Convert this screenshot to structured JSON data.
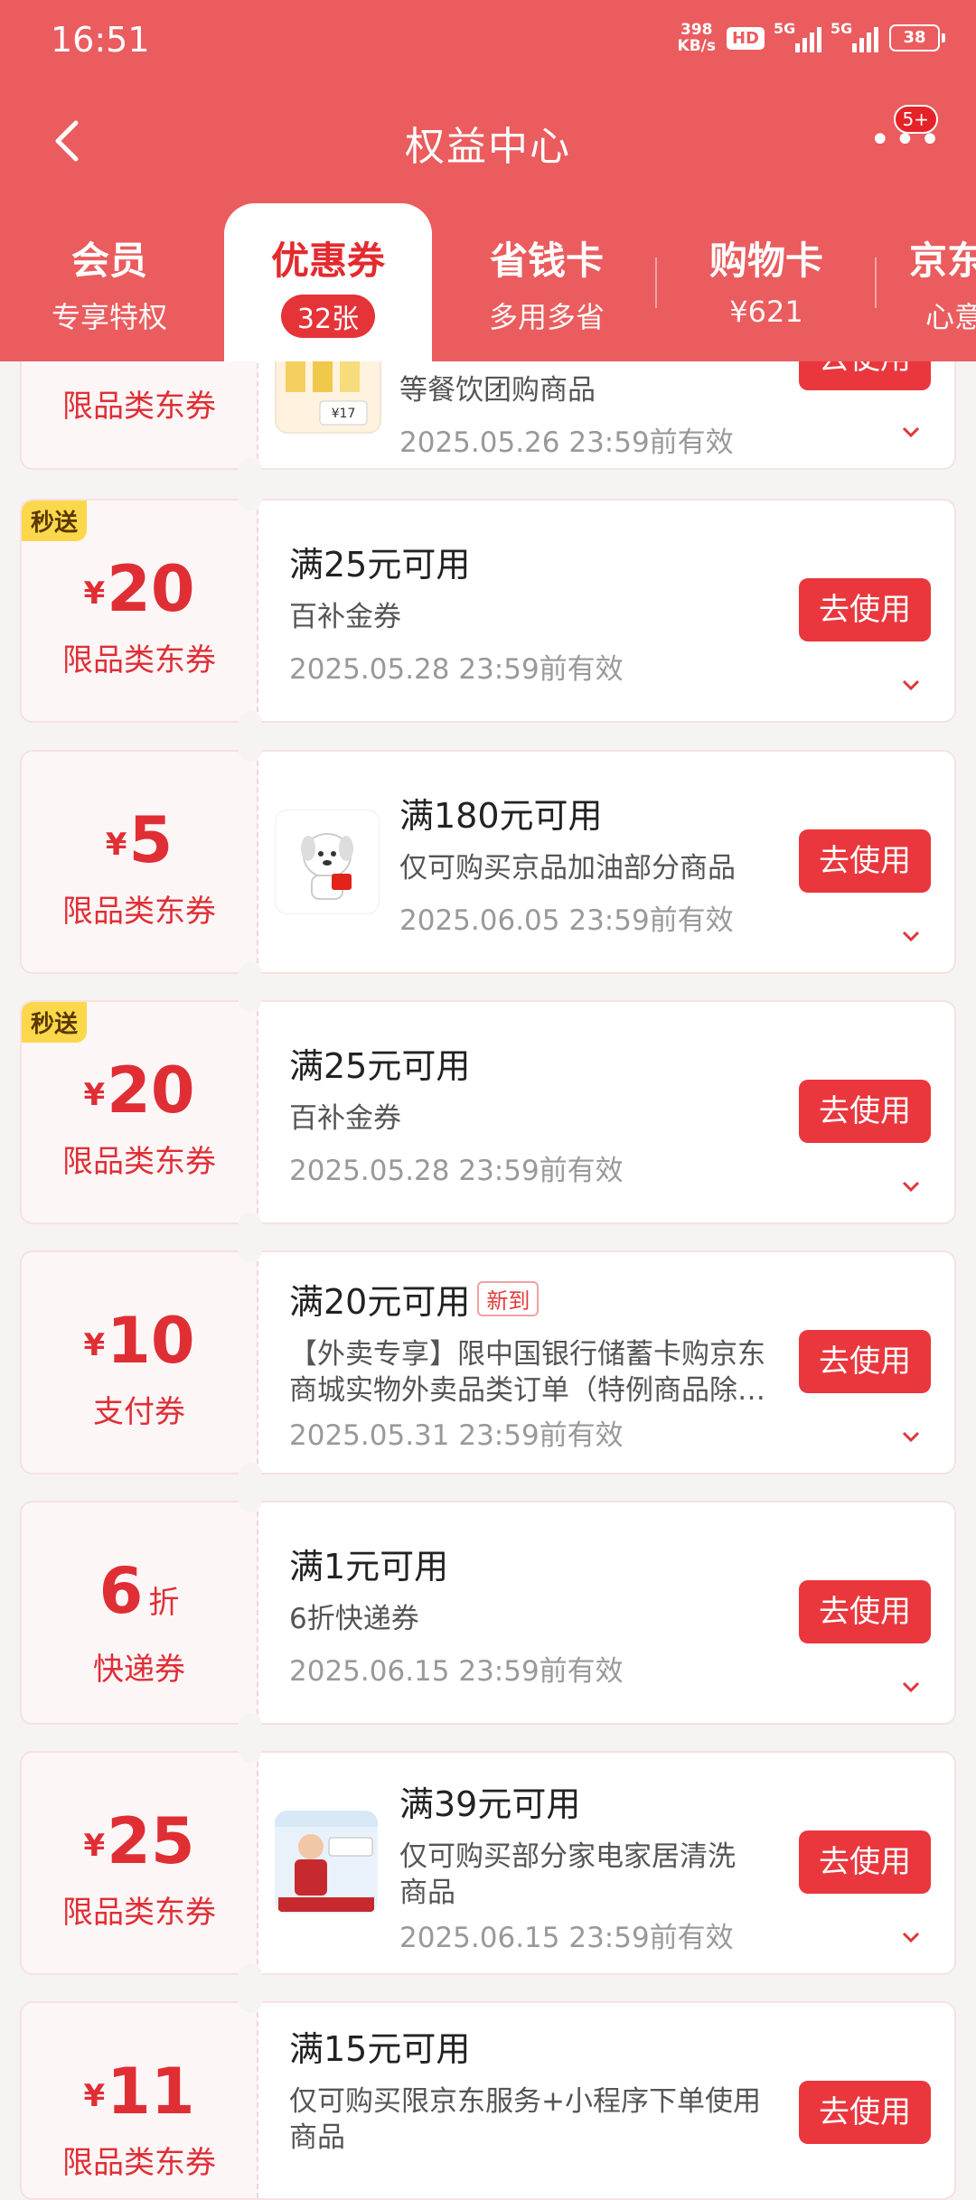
{
  "status_bar": {
    "time": "16:51",
    "speed_top": "398",
    "speed_bottom": "KB/s",
    "hd": "HD",
    "net1": "5G",
    "net2": "5G",
    "battery": "38"
  },
  "nav": {
    "title": "权益中心",
    "more_badge": "5+"
  },
  "tabs": [
    {
      "title": "会员",
      "sub": "专享特权"
    },
    {
      "title": "优惠券",
      "sub": "32张"
    },
    {
      "title": "省钱卡",
      "sub": "多用多省"
    },
    {
      "title": "购物卡",
      "sub": "¥621"
    },
    {
      "title": "京东",
      "sub": "心意"
    }
  ],
  "coupons": [
    {
      "tag": "",
      "yen": "",
      "amount": "",
      "suffix": "",
      "type": "限品类东券",
      "condition": "",
      "new": "",
      "desc1": "等餐饮团购商品",
      "desc2": "",
      "expire": "2025.05.26 23:59前有效",
      "thumb_label": "¥17",
      "button": "去使用"
    },
    {
      "tag": "秒送",
      "yen": "¥",
      "amount": "20",
      "suffix": "",
      "type": "限品类东券",
      "condition": "满25元可用",
      "new": "",
      "desc1": "百补金券",
      "desc2": "",
      "expire": "2025.05.28 23:59前有效",
      "button": "去使用"
    },
    {
      "tag": "",
      "yen": "¥",
      "amount": "5",
      "suffix": "",
      "type": "限品类东券",
      "condition": "满180元可用",
      "new": "",
      "desc1": "仅可购买京品加油部分商品",
      "desc2": "",
      "expire": "2025.06.05 23:59前有效",
      "button": "去使用"
    },
    {
      "tag": "秒送",
      "yen": "¥",
      "amount": "20",
      "suffix": "",
      "type": "限品类东券",
      "condition": "满25元可用",
      "new": "",
      "desc1": "百补金券",
      "desc2": "",
      "expire": "2025.05.28 23:59前有效",
      "button": "去使用"
    },
    {
      "tag": "",
      "yen": "¥",
      "amount": "10",
      "suffix": "",
      "type": "支付券",
      "condition": "满20元可用",
      "new": "新到",
      "desc1": "【外卖专享】限中国银行储蓄卡购京东",
      "desc2": "商城实物外卖品类订单（特例商品除…",
      "expire": "2025.05.31 23:59前有效",
      "button": "去使用"
    },
    {
      "tag": "",
      "yen": "",
      "amount": "6",
      "suffix": "折",
      "type": "快递券",
      "condition": "满1元可用",
      "new": "",
      "desc1": "6折快递券",
      "desc2": "",
      "expire": "2025.06.15 23:59前有效",
      "button": "去使用"
    },
    {
      "tag": "",
      "yen": "¥",
      "amount": "25",
      "suffix": "",
      "type": "限品类东券",
      "condition": "满39元可用",
      "new": "",
      "desc1": "仅可购买部分家电家居清洗",
      "desc2": "商品",
      "expire": "2025.06.15 23:59前有效",
      "button": "去使用"
    },
    {
      "tag": "",
      "yen": "¥",
      "amount": "11",
      "suffix": "",
      "type": "限品类东券",
      "condition": "满15元可用",
      "new": "",
      "desc1": "仅可购买限京东服务+小程序下单使用",
      "desc2": "商品",
      "expire": "",
      "button": "去使用"
    }
  ],
  "colors": {
    "header": "#ea5c5e",
    "accent": "#e42a2e",
    "button": "#e9373d",
    "tag": "#fbd84b"
  }
}
